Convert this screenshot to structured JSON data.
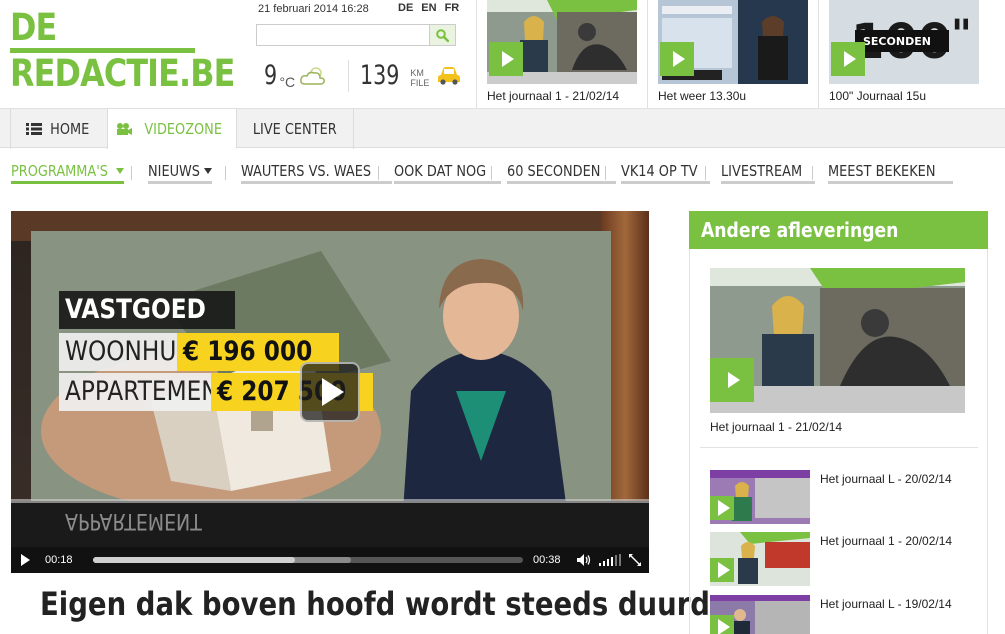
{
  "header": {
    "logo_line1": "DE",
    "logo_line2": "REDACTIE.BE",
    "datetime": "21 februari 2014 16:28",
    "languages": [
      "DE",
      "EN",
      "FR"
    ],
    "search_placeholder": "",
    "weather_value": "9",
    "weather_unit": "°C",
    "weather_icon": "cloudy-icon",
    "traffic_value": "139",
    "traffic_unit_line1": "KM",
    "traffic_unit_line2": "FILE",
    "traffic_icon": "car-icon"
  },
  "top_videos": [
    {
      "caption": "Het journaal 1 - 21/02/14"
    },
    {
      "caption": "Het weer 13.30u"
    },
    {
      "caption": "100\" Journaal 15u",
      "overlay": "SECONDEN"
    }
  ],
  "main_nav": [
    {
      "label": "HOME",
      "icon": "list-icon"
    },
    {
      "label": "VIDEOZONE",
      "icon": "camera-icon",
      "active": true
    },
    {
      "label": "LIVE CENTER"
    }
  ],
  "sub_nav": [
    {
      "label": "PROGRAMMA'S",
      "active": true,
      "dropdown": true
    },
    {
      "label": "NIEUWS",
      "dropdown": true
    },
    {
      "label": "WAUTERS VS. WAES"
    },
    {
      "label": "OOK DAT NOG"
    },
    {
      "label": "60 SECONDEN"
    },
    {
      "label": "VK14 OP TV"
    },
    {
      "label": "LIVESTREAM"
    },
    {
      "label": "MEEST BEKEKEN"
    }
  ],
  "player": {
    "overlay_title": "VASTGOED",
    "overlay_row1_label": "WOONHUIS",
    "overlay_row1_value": "€ 196 000",
    "overlay_row2_label": "APPARTEMENT",
    "overlay_row2_value": "€ 207 500",
    "reflection_text": "APPARTEMENT",
    "time_current": "00:18",
    "time_total": "00:38",
    "progress": 0.47,
    "buffered": 0.6
  },
  "article": {
    "headline": "Eigen dak boven hoofd wordt steeds duurder"
  },
  "sidebar": {
    "title": "Andere afleveringen",
    "featured_caption": "Het journaal 1 - 21/02/14",
    "items": [
      {
        "caption": "Het journaal L - 20/02/14"
      },
      {
        "caption": "Het journaal 1 - 20/02/14"
      },
      {
        "caption": "Het journaal L - 19/02/14"
      }
    ]
  },
  "colors": {
    "brand_green": "#7ac142",
    "overlay_yellow": "#f7d21e"
  }
}
